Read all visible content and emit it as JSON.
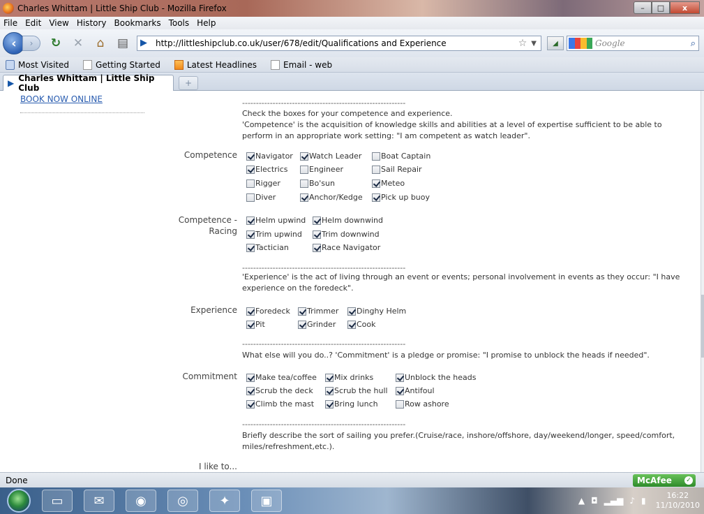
{
  "window": {
    "title": "Charles Whittam | Little Ship Club - Mozilla Firefox",
    "minimize": "–",
    "maximize": "□",
    "close": "x"
  },
  "menu": [
    "File",
    "Edit",
    "View",
    "History",
    "Bookmarks",
    "Tools",
    "Help"
  ],
  "navbar": {
    "url": "http://littleshipclub.co.uk/user/678/edit/Qualifications and Experience",
    "search_placeholder": "Google"
  },
  "bookmarks": [
    "Most Visited",
    "Getting Started",
    "Latest Headlines",
    "Email - web"
  ],
  "tab": {
    "title": "Charles Whittam | Little Ship Club",
    "new_tab": "+"
  },
  "page": {
    "book_now": "BOOK NOW ONLINE",
    "dash_line": "-----------------------------------------------------------",
    "competence_intro_1": "Check the boxes for your competence and experience.",
    "competence_intro_2": "'Competence' is the acquisition of knowledge skills and abilities at a level of expertise sufficient to be able to perform in an appropriate work setting: \"I am competent as watch leader\".",
    "competence_label": "Competence",
    "competence_items": [
      {
        "label": "Navigator",
        "checked": true
      },
      {
        "label": "Watch Leader",
        "checked": true
      },
      {
        "label": "Boat Captain",
        "checked": false
      },
      {
        "label": "Electrics",
        "checked": true
      },
      {
        "label": "Engineer",
        "checked": false
      },
      {
        "label": "Sail Repair",
        "checked": false
      },
      {
        "label": "Rigger",
        "checked": false
      },
      {
        "label": "Bo'sun",
        "checked": false
      },
      {
        "label": "Meteo",
        "checked": true
      },
      {
        "label": "Diver",
        "checked": false
      },
      {
        "label": "Anchor/Kedge",
        "checked": true
      },
      {
        "label": "Pick up buoy",
        "checked": true
      }
    ],
    "racing_label_1": "Competence -",
    "racing_label_2": "Racing",
    "racing_items": [
      {
        "label": "Helm upwind",
        "checked": true
      },
      {
        "label": "Helm downwind",
        "checked": true
      },
      {
        "label": "Trim upwind",
        "checked": true
      },
      {
        "label": "Trim downwind",
        "checked": true
      },
      {
        "label": "Tactician",
        "checked": true
      },
      {
        "label": "Race Navigator",
        "checked": true
      }
    ],
    "experience_intro": "'Experience' is the act of living through an event or events; personal involvement in events as they occur: \"I have experience on the foredeck\".",
    "experience_label": "Experience",
    "experience_items": [
      {
        "label": "Foredeck",
        "checked": true
      },
      {
        "label": "Trimmer",
        "checked": true
      },
      {
        "label": "Dinghy Helm",
        "checked": true
      },
      {
        "label": "Pit",
        "checked": true
      },
      {
        "label": "Grinder",
        "checked": true
      },
      {
        "label": "Cook",
        "checked": true
      }
    ],
    "commitment_intro": "What else will you do..? 'Commitment' is a pledge or promise: \"I promise to unblock the heads if needed\".",
    "commitment_label": "Commitment",
    "commitment_items": [
      {
        "label": "Make tea/coffee",
        "checked": true
      },
      {
        "label": "Mix drinks",
        "checked": true
      },
      {
        "label": "Unblock the heads",
        "checked": true
      },
      {
        "label": "Scrub the deck",
        "checked": true
      },
      {
        "label": "Scrub the hull",
        "checked": true
      },
      {
        "label": "Antifoul",
        "checked": true
      },
      {
        "label": "Climb the mast",
        "checked": true
      },
      {
        "label": "Bring lunch",
        "checked": true
      },
      {
        "label": "Row ashore",
        "checked": false
      }
    ],
    "sailing_intro": "Briefly describe the sort of sailing you prefer.(Cruise/race, inshore/offshore, day/weekend/longer, speed/comfort, miles/refreshment,etc.).",
    "ilike_label": "I like to..."
  },
  "status": {
    "text": "Done",
    "mcafee": "McAfee"
  },
  "taskbar": {
    "time": "16:22",
    "date": "11/10/2010"
  }
}
